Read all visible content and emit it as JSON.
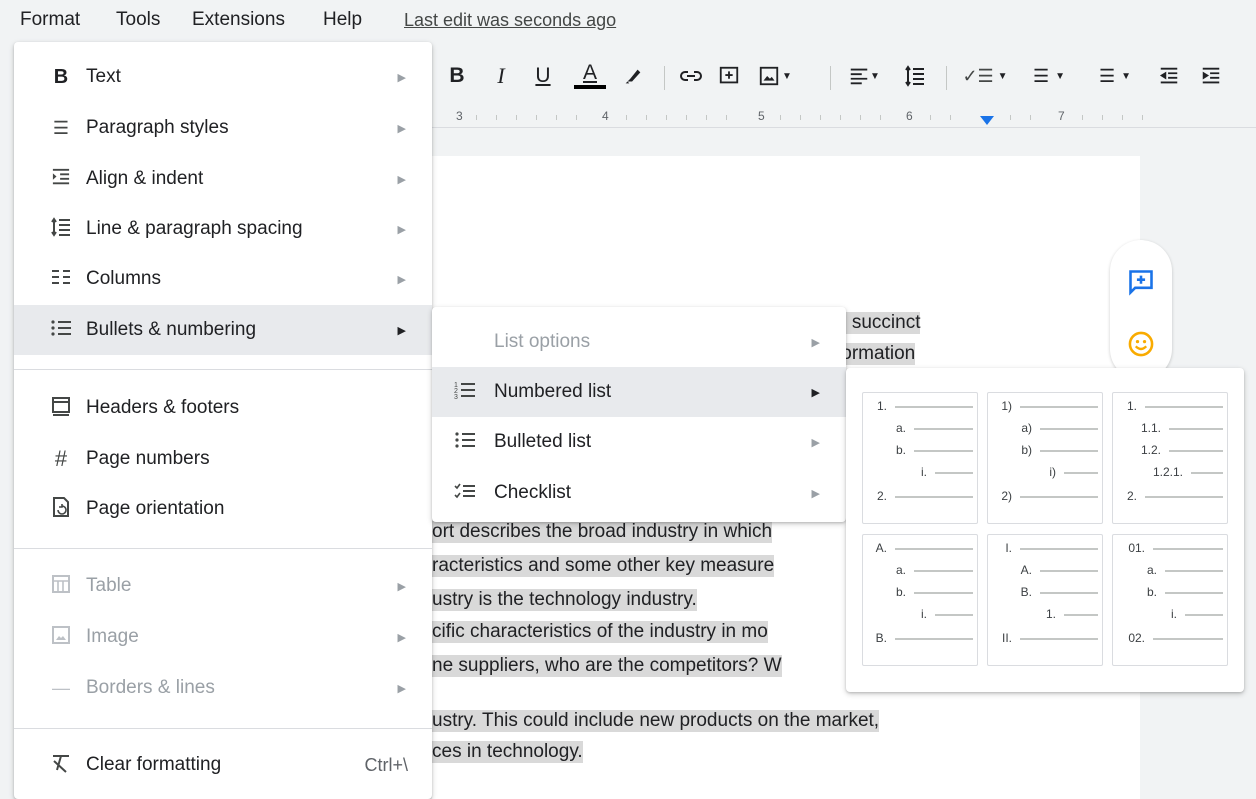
{
  "menubar": {
    "items": [
      "Format",
      "Tools",
      "Extensions",
      "Help"
    ],
    "last_edit": "Last edit was seconds ago"
  },
  "ruler": {
    "numbers": [
      "3",
      "4",
      "5",
      "6",
      "7"
    ]
  },
  "format_menu": {
    "items": [
      {
        "label": "Text",
        "icon": "bold-icon",
        "submenu": true
      },
      {
        "label": "Paragraph styles",
        "icon": "paragraph-styles-icon",
        "submenu": true
      },
      {
        "label": "Align & indent",
        "icon": "indent-icon",
        "submenu": true
      },
      {
        "label": "Line & paragraph spacing",
        "icon": "line-spacing-icon",
        "submenu": true
      },
      {
        "label": "Columns",
        "icon": "columns-icon",
        "submenu": true
      },
      {
        "label": "Bullets & numbering",
        "icon": "bulleted-list-icon",
        "submenu": true,
        "active": true
      },
      {
        "label": "Headers & footers",
        "icon": "header-footer-icon"
      },
      {
        "label": "Page numbers",
        "icon": "hash-icon"
      },
      {
        "label": "Page orientation",
        "icon": "page-orientation-icon"
      },
      {
        "label": "Table",
        "icon": "table-icon",
        "submenu": true,
        "disabled": true
      },
      {
        "label": "Image",
        "icon": "image-icon",
        "submenu": true,
        "disabled": true
      },
      {
        "label": "Borders & lines",
        "icon": "borders-icon",
        "submenu": true,
        "disabled": true
      },
      {
        "label": "Clear formatting",
        "icon": "clear-formatting-icon",
        "shortcut": "Ctrl+\\"
      }
    ]
  },
  "bullets_submenu": {
    "items": [
      {
        "label": "List options",
        "disabled": true,
        "submenu": true
      },
      {
        "label": "Numbered list",
        "icon": "numbered-list-icon",
        "submenu": true,
        "active": true
      },
      {
        "label": "Bulleted list",
        "icon": "bulleted-list-icon",
        "submenu": true
      },
      {
        "label": "Checklist",
        "icon": "checklist-icon",
        "submenu": true
      }
    ]
  },
  "numbered_gallery": {
    "presets": [
      [
        "1.",
        "a.",
        "b.",
        "i.",
        "2."
      ],
      [
        "1)",
        "a)",
        "b)",
        "i)",
        "2)"
      ],
      [
        "1.",
        "1.1.",
        "1.2.",
        "1.2.1.",
        "2."
      ],
      [
        "A.",
        "a.",
        "b.",
        "i.",
        "B."
      ],
      [
        "I.",
        "A.",
        "B.",
        "1.",
        "II."
      ],
      [
        "01.",
        "a.",
        "b.",
        "i.",
        "02."
      ]
    ]
  },
  "document": {
    "frag1": "e succinct",
    "frag2": "formation",
    "lines": [
      "ort describes the broad industry in which",
      "racteristics and some other key measure",
      "ustry is the technology industry.",
      "cific characteristics of the industry in mo",
      "ne suppliers, who are the competitors? W",
      "ustry.  This could include new products on the market,",
      "ces in technology."
    ]
  },
  "colors": {
    "accent": "#1a73e8",
    "emoji": "#f9ab00",
    "menu_active": "#e8eaed"
  }
}
